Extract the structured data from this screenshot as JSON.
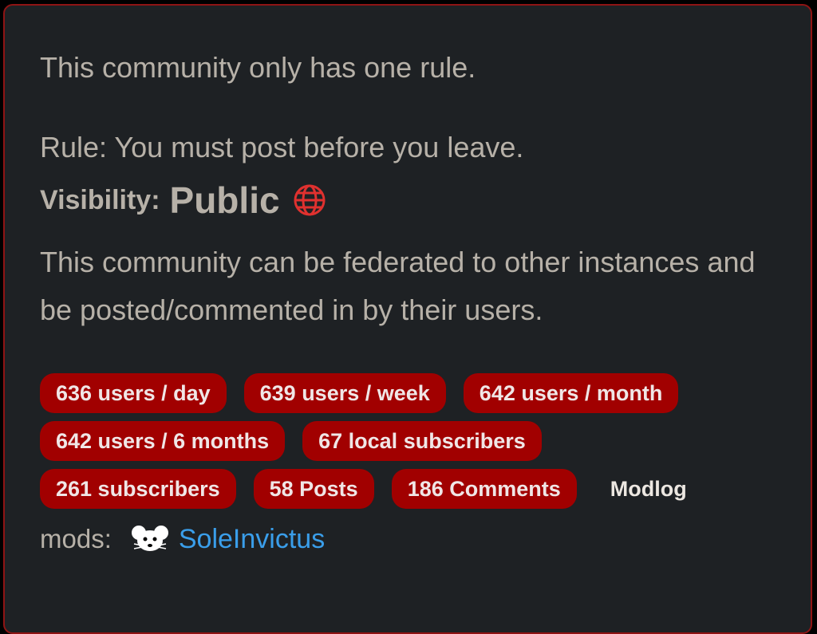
{
  "sidebar": {
    "intro": "This community only has one rule.",
    "rule": "Rule: You must post before you leave.",
    "visibility": {
      "label": "Visibility:",
      "value": "Public",
      "icon": "globe-icon"
    },
    "federation_note": "This community can be federated to other instances and be posted/commented in by their users.",
    "stats": {
      "users_day": "636 users / day",
      "users_week": "639 users / week",
      "users_month": "642 users / month",
      "users_6_months": "642 users / 6 months",
      "local_subscribers": "67 local subscribers",
      "subscribers": "261 subscribers",
      "posts": "58 Posts",
      "comments": "186 Comments"
    },
    "modlog_label": "Modlog",
    "mods": {
      "label": "mods:",
      "moderators": [
        {
          "name": "SoleInvictus",
          "avatar_icon": "mouse-avatar-icon"
        }
      ]
    }
  },
  "colors": {
    "background": "#1e2124",
    "border": "#8f1414",
    "badge": "#a10000",
    "text": "#b7b1a8",
    "link": "#3a9eea",
    "globe": "#e0312f"
  }
}
